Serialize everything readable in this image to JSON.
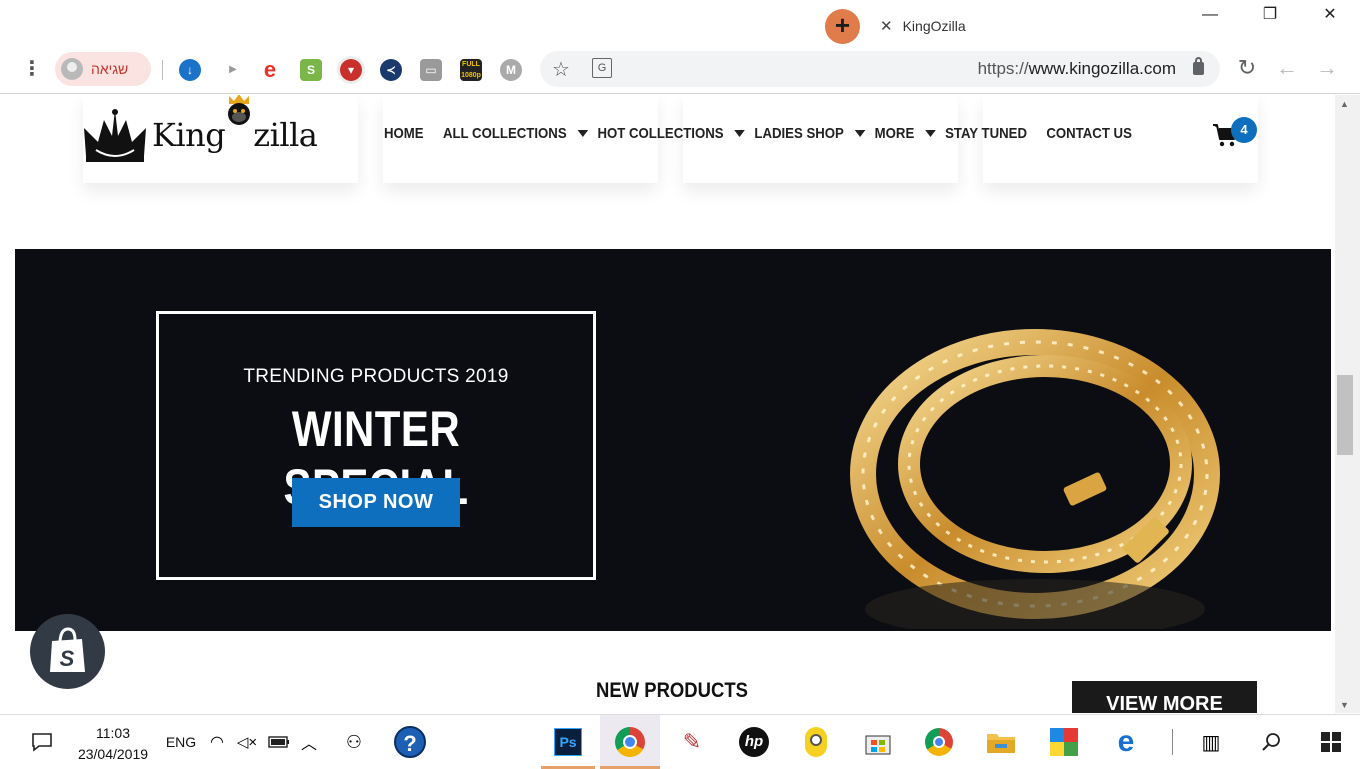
{
  "browser": {
    "tab_title": "KingOzilla",
    "profile_label": "שגיאה",
    "url_prefix": "https://",
    "url_host": "www.kingozilla.com",
    "new_tab_symbol": "+",
    "close_tab_symbol": "✕",
    "window_controls": [
      "—",
      "❐",
      "✕"
    ],
    "extensions": [
      "download-icon",
      "play-icon",
      "e-icon",
      "shopify-icon",
      "shield-icon",
      "share-icon",
      "cast-icon",
      "hd-1080p-icon",
      "m-icon"
    ]
  },
  "site": {
    "logo_text": "King",
    "logo_text_2": "zilla",
    "nav": [
      "HOME",
      "ALL COLLECTIONS",
      "HOT COLLECTIONS",
      "LADIES SHOP",
      "MORE",
      "STAY TUNED",
      "CONTACT US"
    ],
    "cart_count": "4",
    "hero": {
      "subtitle": "TRENDING PRODUCTS 2019",
      "title": "WINTER SPECIAL",
      "button": "SHOP NOW"
    },
    "new_products_heading": "NEW PRODUCTS",
    "view_more": "VIEW MORE"
  },
  "taskbar": {
    "time": "11:03",
    "date": "23/04/2019",
    "language": "ENG",
    "apps": [
      "action-center-icon",
      "help-icon",
      "photoshop-icon",
      "chrome-profile-icon",
      "syringe-icon",
      "hp-icon",
      "minion-icon",
      "store-icon",
      "chrome-icon",
      "file-explorer-icon",
      "puzzle-icon",
      "edge-icon",
      "task-view-icon",
      "search-icon",
      "start-icon"
    ]
  },
  "colors": {
    "accent_blue": "#0f6fbf",
    "hero_bg": "#0c0d12",
    "new_tab_orange": "#e07b4a",
    "profile_chip": "#fbe3e1"
  }
}
